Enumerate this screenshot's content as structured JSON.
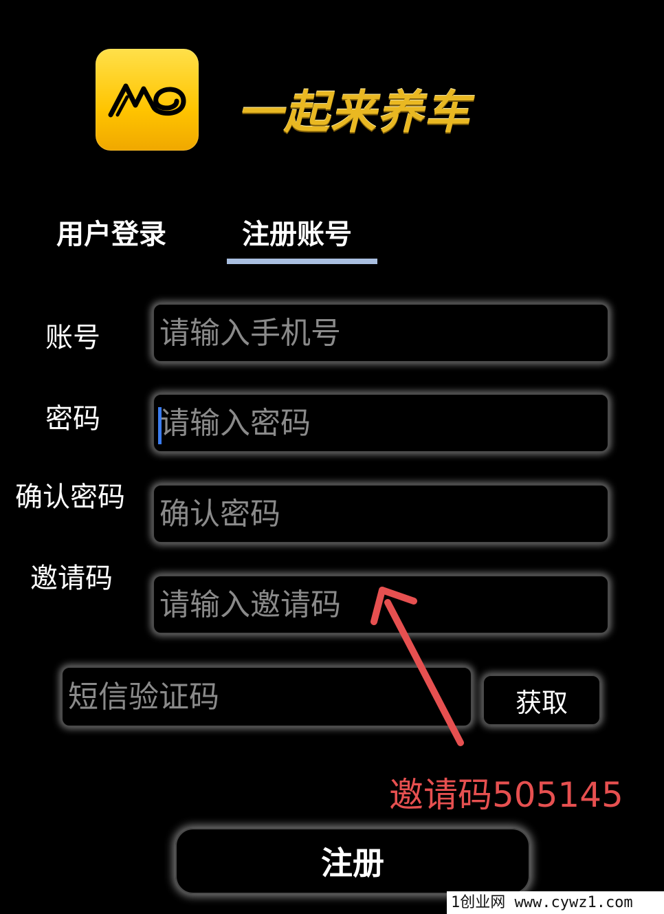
{
  "app": {
    "title": "一起来养车",
    "logo_color": "#ffc400"
  },
  "tabs": [
    {
      "label": "用户登录",
      "active": false
    },
    {
      "label": "注册账号",
      "active": true
    }
  ],
  "form": {
    "account": {
      "label": "账号",
      "placeholder": "请输入手机号"
    },
    "password": {
      "label": "密码",
      "placeholder": "请输入密码"
    },
    "confirm_password": {
      "label": "确认密码",
      "placeholder": "确认密码"
    },
    "invite_code": {
      "label": "邀请码",
      "placeholder": "请输入邀请码"
    },
    "sms_code": {
      "placeholder": "短信验证码"
    },
    "get_code_label": "获取",
    "submit_label": "注册"
  },
  "annotation": {
    "text": "邀请码505145",
    "color": "#e65050"
  },
  "watermark": "1创业网 www.cywz1.com"
}
